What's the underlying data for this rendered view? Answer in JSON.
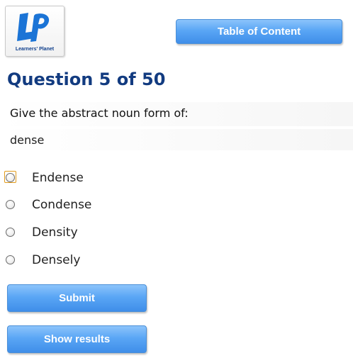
{
  "logo": {
    "initials": "LP",
    "name": "Learners' Planet"
  },
  "header": {
    "toc_label": "Table of Content"
  },
  "question": {
    "title": "Question 5 of 50",
    "prompt": "Give the abstract noun form of:",
    "word": "dense",
    "options": [
      "Endense",
      "Condense",
      "Density",
      "Densely"
    ],
    "focused_option": 0
  },
  "actions": {
    "submit_label": "Submit",
    "results_label": "Show results"
  },
  "colors": {
    "accent": "#4a96ef",
    "title": "#123b80",
    "focus": "#e09a1a"
  }
}
